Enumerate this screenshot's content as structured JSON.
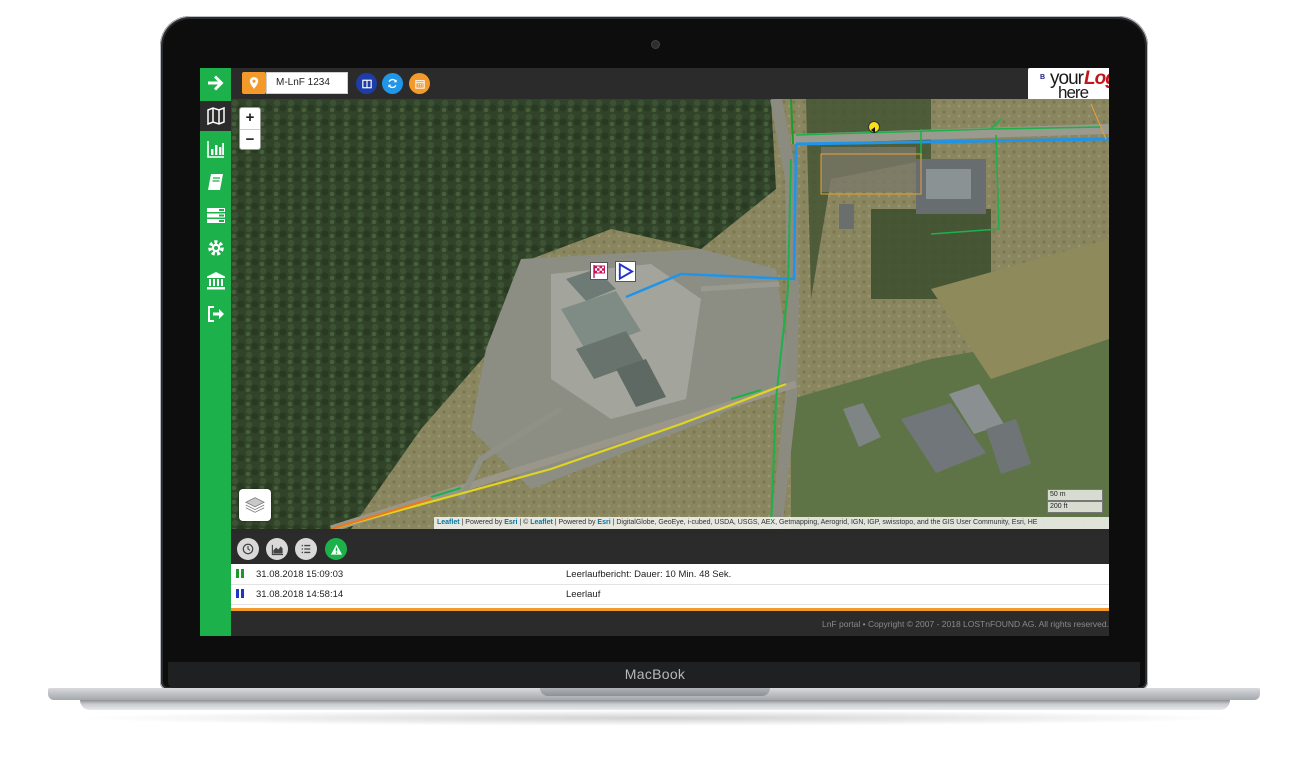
{
  "device": {
    "brand": "MacBook"
  },
  "sidebar": {
    "items": [
      {
        "icon": "arrow-right-icon"
      },
      {
        "icon": "map-icon"
      },
      {
        "icon": "bar-chart-icon"
      },
      {
        "icon": "book-icon"
      },
      {
        "icon": "list-icon"
      },
      {
        "icon": "gear-icon"
      },
      {
        "icon": "bank-icon"
      },
      {
        "icon": "logout-icon"
      }
    ],
    "color": "#1db14b"
  },
  "toolbar": {
    "vehicle": "M-LnF 1234",
    "colors": {
      "pin": "#f39a2a",
      "split": "#1f3da8",
      "refresh": "#2096e8",
      "calendar": "#f39a2a"
    }
  },
  "logo": {
    "your": "your",
    "logo": "Logo",
    "here": "here",
    "reg": "®",
    "b": "B"
  },
  "map": {
    "zoom_in": "+",
    "zoom_out": "−",
    "scale": [
      "50 m",
      "200 ft"
    ],
    "attribution": {
      "leaflet1": "Leaflet",
      "sep1": " | Powered by ",
      "esri1": "Esri",
      "sep2": " | © ",
      "leaflet2": "Leaflet",
      "sep3": " | Powered by ",
      "esri2": "Esri",
      "rest": " | DigitalGlobe, GeoEye, i-cubed, USDA, USGS, AEX, Getmapping, Aerogrid, IGN, IGP, swisstopo, and the GIS User Community, Esri, HE"
    }
  },
  "panel": {
    "buttons": [
      {
        "icon": "clock-icon",
        "color": "#d9d9d9"
      },
      {
        "icon": "area-chart-icon",
        "color": "#d9d9d9"
      },
      {
        "icon": "list-icon",
        "color": "#d9d9d9"
      },
      {
        "icon": "warning-icon",
        "color": "#1db14b"
      }
    ],
    "rows": [
      {
        "timestamp": "31.08.2018 15:09:03",
        "description": "Leerlaufbericht: Dauer: 10 Min. 48 Sek.",
        "color": "#1a9a2a"
      },
      {
        "timestamp": "31.08.2018 14:58:14",
        "description": "Leerlauf",
        "color": "#1f35c8"
      }
    ]
  },
  "footer": {
    "text": "LnF portal • Copyright © 2007 - 2018 LOSTnFOUND AG. All rights reserved."
  }
}
